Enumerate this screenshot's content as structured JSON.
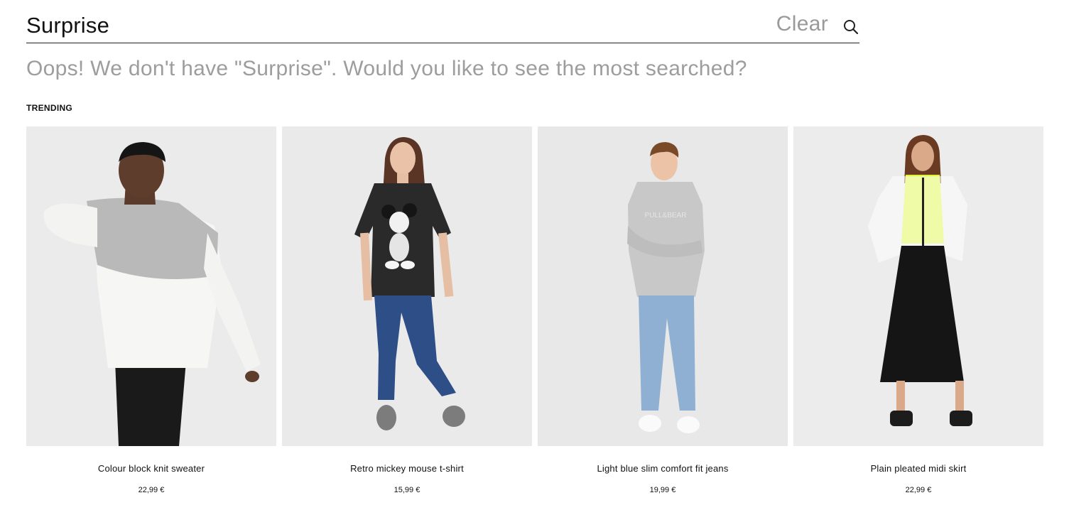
{
  "search": {
    "value": "Surprise",
    "clear_label": "Clear",
    "icon": "search-icon"
  },
  "message": "Oops! We don't have \"Surprise\". Would you like to see the most searched?",
  "trending_label": "TRENDING",
  "products": [
    {
      "name": "Colour block knit sweater",
      "price": "22,99 €",
      "image": "model-colour-block-sweater"
    },
    {
      "name": "Retro mickey mouse t-shirt",
      "price": "15,99 €",
      "image": "model-mickey-tshirt"
    },
    {
      "name": "Light blue slim comfort fit jeans",
      "price": "19,99 €",
      "image": "model-light-blue-jeans"
    },
    {
      "name": "Plain pleated midi skirt",
      "price": "22,99 €",
      "image": "model-pleated-skirt"
    }
  ],
  "colors": {
    "accent_text": "#111111",
    "muted_text": "#9d9d9d",
    "photo_bg": "#ebebeb"
  }
}
